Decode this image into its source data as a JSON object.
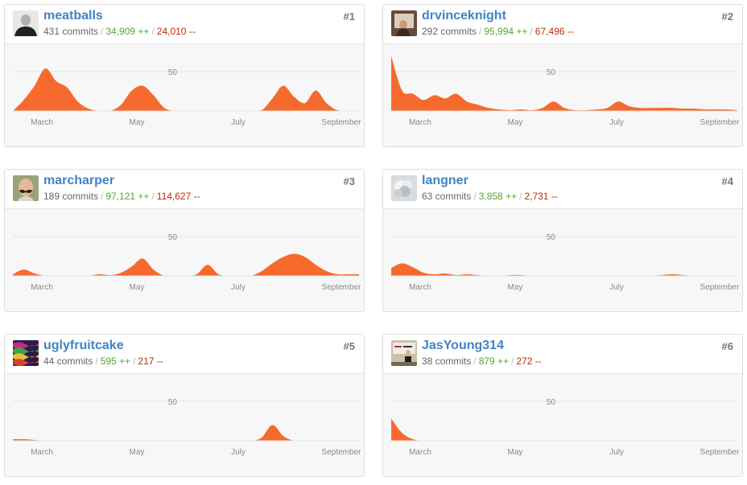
{
  "colors": {
    "accent": "#f66a2d",
    "link": "#4183c4",
    "additions": "#55a532",
    "deletions": "#bd2c00"
  },
  "chart_data": [
    {
      "type": "area",
      "rank": "#1",
      "username": "meatballs",
      "commits_text": "431 commits",
      "additions_text": "34,909 ++",
      "deletions_text": "24,010 --",
      "x_tick_labels": [
        "March",
        "May",
        "July",
        "September"
      ],
      "y_tick_labels": [
        "50"
      ],
      "ylim": [
        0,
        100
      ],
      "weeks": [
        0,
        1,
        2,
        3,
        4,
        5,
        6,
        7,
        8,
        9,
        10,
        11,
        12,
        13,
        14,
        15,
        16,
        17,
        18,
        19,
        20,
        21,
        22,
        23,
        24,
        25,
        26,
        27,
        28,
        29,
        30,
        31,
        32
      ],
      "values": [
        0,
        14,
        32,
        54,
        38,
        30,
        12,
        3,
        0,
        0,
        8,
        26,
        32,
        20,
        4,
        0,
        0,
        0,
        0,
        0,
        0,
        0,
        0,
        1,
        16,
        32,
        18,
        10,
        26,
        10,
        1,
        0,
        0
      ]
    },
    {
      "type": "area",
      "rank": "#2",
      "username": "drvinceknight",
      "commits_text": "292 commits",
      "additions_text": "95,994 ++",
      "deletions_text": "67,496 --",
      "x_tick_labels": [
        "March",
        "May",
        "July",
        "September"
      ],
      "y_tick_labels": [
        "50"
      ],
      "ylim": [
        0,
        100
      ],
      "weeks": [
        0,
        1,
        2,
        3,
        4,
        5,
        6,
        7,
        8,
        9,
        10,
        11,
        12,
        13,
        14,
        15,
        16,
        17,
        18,
        19,
        20,
        21,
        22,
        23,
        24,
        25,
        26,
        27,
        28,
        29,
        30,
        31,
        32
      ],
      "values": [
        70,
        26,
        22,
        14,
        20,
        16,
        22,
        12,
        8,
        4,
        2,
        1,
        2,
        1,
        4,
        12,
        4,
        1,
        1,
        2,
        4,
        12,
        6,
        4,
        4,
        4,
        4,
        3,
        3,
        2,
        2,
        2,
        1
      ]
    },
    {
      "type": "area",
      "rank": "#3",
      "username": "marcharper",
      "commits_text": "189 commits",
      "additions_text": "97,121 ++",
      "deletions_text": "114,627 --",
      "x_tick_labels": [
        "March",
        "May",
        "July",
        "September"
      ],
      "y_tick_labels": [
        "50"
      ],
      "ylim": [
        0,
        100
      ],
      "weeks": [
        0,
        1,
        2,
        3,
        4,
        5,
        6,
        7,
        8,
        9,
        10,
        11,
        12,
        13,
        14,
        15,
        16,
        17,
        18,
        19,
        20,
        21,
        22,
        23,
        24,
        25,
        26,
        27,
        28,
        29,
        30,
        31,
        32
      ],
      "values": [
        2,
        8,
        3,
        0,
        0,
        0,
        0,
        0,
        2,
        1,
        4,
        12,
        22,
        8,
        0,
        0,
        0,
        2,
        14,
        2,
        0,
        0,
        0,
        6,
        16,
        24,
        28,
        24,
        14,
        6,
        2,
        2,
        2
      ]
    },
    {
      "type": "area",
      "rank": "#4",
      "username": "langner",
      "commits_text": "63 commits",
      "additions_text": "3,858 ++",
      "deletions_text": "2,731 --",
      "x_tick_labels": [
        "March",
        "May",
        "July",
        "September"
      ],
      "y_tick_labels": [
        "50"
      ],
      "ylim": [
        0,
        100
      ],
      "weeks": [
        0,
        1,
        2,
        3,
        4,
        5,
        6,
        7,
        8,
        9,
        10,
        11,
        12,
        13,
        14,
        15,
        16,
        17,
        18,
        19,
        20,
        21,
        22,
        23,
        24,
        25,
        26,
        27,
        28,
        29,
        30,
        31,
        32
      ],
      "values": [
        10,
        16,
        11,
        4,
        2,
        3,
        1,
        2,
        1,
        0,
        0,
        1,
        1,
        0,
        0,
        0,
        0,
        0,
        0,
        0,
        0,
        0,
        0,
        0,
        0,
        1,
        2,
        1,
        0,
        0,
        0,
        0,
        0
      ]
    },
    {
      "type": "area",
      "rank": "#5",
      "username": "uglyfruitcake",
      "commits_text": "44 commits",
      "additions_text": "595 ++",
      "deletions_text": "217 --",
      "x_tick_labels": [
        "March",
        "May",
        "July",
        "September"
      ],
      "y_tick_labels": [
        "50"
      ],
      "ylim": [
        0,
        100
      ],
      "weeks": [
        0,
        1,
        2,
        3,
        4,
        5,
        6,
        7,
        8,
        9,
        10,
        11,
        12,
        13,
        14,
        15,
        16,
        17,
        18,
        19,
        20,
        21,
        22,
        23,
        24,
        25,
        26,
        27,
        28,
        29,
        30,
        31,
        32
      ],
      "values": [
        2,
        2,
        1,
        0,
        0,
        0,
        0,
        0,
        0,
        0,
        0,
        0,
        0,
        0,
        0,
        0,
        0,
        0,
        0,
        0,
        0,
        0,
        0,
        4,
        20,
        6,
        0,
        0,
        0,
        0,
        0,
        0,
        0
      ]
    },
    {
      "type": "area",
      "rank": "#6",
      "username": "JasYoung314",
      "commits_text": "38 commits",
      "additions_text": "879 ++",
      "deletions_text": "272 --",
      "x_tick_labels": [
        "March",
        "May",
        "July",
        "September"
      ],
      "y_tick_labels": [
        "50"
      ],
      "ylim": [
        0,
        100
      ],
      "weeks": [
        0,
        1,
        2,
        3,
        4,
        5,
        6,
        7,
        8,
        9,
        10,
        11,
        12,
        13,
        14,
        15,
        16,
        17,
        18,
        19,
        20,
        21,
        22,
        23,
        24,
        25,
        26,
        27,
        28,
        29,
        30,
        31,
        32
      ],
      "values": [
        28,
        10,
        2,
        0,
        0,
        0,
        0,
        0,
        0,
        0,
        0,
        0,
        0,
        0,
        0,
        0,
        0,
        0,
        0,
        0,
        0,
        0,
        0,
        0,
        0,
        0,
        0,
        0,
        0,
        0,
        0,
        0,
        0
      ]
    }
  ]
}
